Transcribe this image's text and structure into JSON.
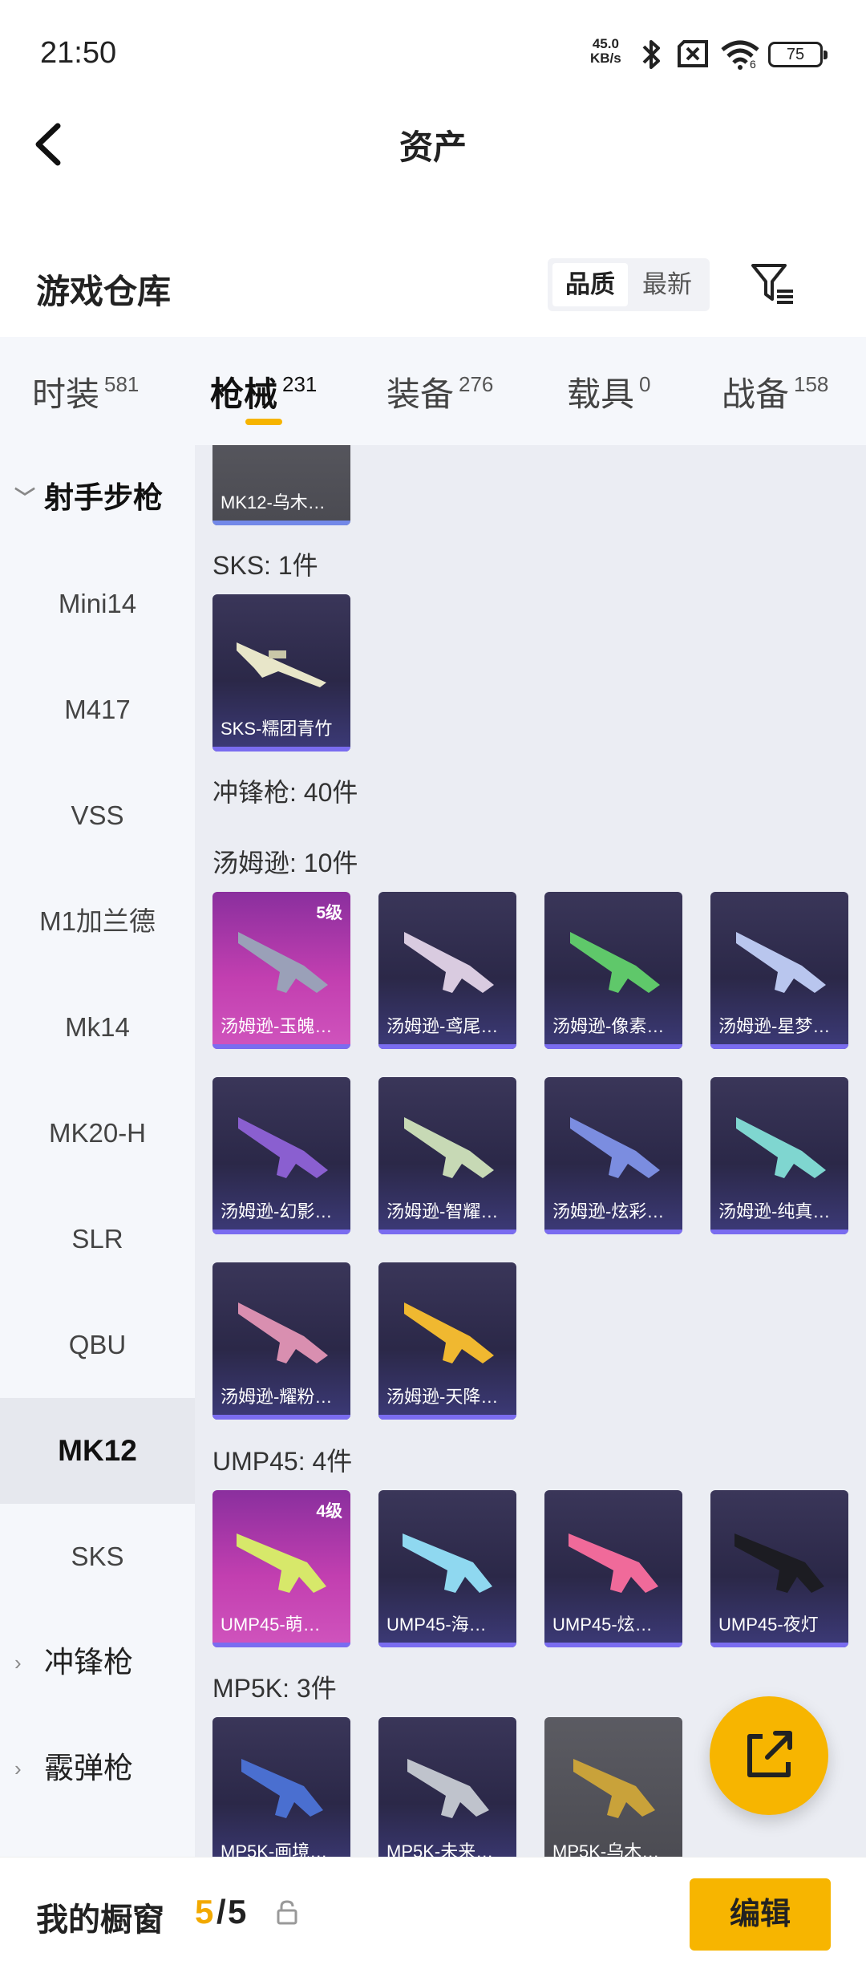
{
  "status_bar": {
    "time": "21:50",
    "net_speed": "45.0",
    "net_unit": "KB/s",
    "wifi_level": "6",
    "battery": "75"
  },
  "header": {
    "title": "资产"
  },
  "warehouse": {
    "title": "游戏仓库",
    "sort_options": [
      "品质",
      "最新"
    ],
    "sort_selected": "品质"
  },
  "tabs": [
    {
      "label": "时装",
      "count": "581",
      "active": false
    },
    {
      "label": "枪械",
      "count": "231",
      "active": true
    },
    {
      "label": "装备",
      "count": "276",
      "active": false
    },
    {
      "label": "载具",
      "count": "0",
      "active": false
    },
    {
      "label": "战备",
      "count": "158",
      "active": false
    }
  ],
  "sidebar": {
    "group_open": "射手步枪",
    "items": [
      "Mini14",
      "M417",
      "VSS",
      "M1加兰德",
      "Mk14",
      "MK20-H",
      "SLR",
      "QBU",
      "MK12",
      "SKS"
    ],
    "selected": "MK12",
    "groups_closed": [
      "冲锋枪",
      "霰弹枪"
    ]
  },
  "content": {
    "partial_top_card": "MK12-乌木…",
    "sections": [
      {
        "heading": "SKS: 1件",
        "items": [
          {
            "name": "SKS-糯团青竹",
            "level": "",
            "style": "purple"
          }
        ]
      },
      {
        "heading": "冲锋枪: 40件",
        "items": []
      },
      {
        "heading": "汤姆逊: 10件",
        "items": [
          {
            "name": "汤姆逊-玉魄…",
            "level": "5级",
            "style": "pink"
          },
          {
            "name": "汤姆逊-鸢尾…",
            "level": "",
            "style": "purple"
          },
          {
            "name": "汤姆逊-像素…",
            "level": "",
            "style": "purple"
          },
          {
            "name": "汤姆逊-星梦…",
            "level": "",
            "style": "purple"
          },
          {
            "name": "汤姆逊-幻影…",
            "level": "",
            "style": "purple"
          },
          {
            "name": "汤姆逊-智耀…",
            "level": "",
            "style": "purple"
          },
          {
            "name": "汤姆逊-炫彩…",
            "level": "",
            "style": "purple"
          },
          {
            "name": "汤姆逊-纯真…",
            "level": "",
            "style": "purple"
          },
          {
            "name": "汤姆逊-耀粉…",
            "level": "",
            "style": "purple"
          },
          {
            "name": "汤姆逊-天降…",
            "level": "",
            "style": "purple"
          }
        ]
      },
      {
        "heading": "UMP45: 4件",
        "items": [
          {
            "name": "UMP45-萌…",
            "level": "4级",
            "style": "pink"
          },
          {
            "name": "UMP45-海…",
            "level": "",
            "style": "purple"
          },
          {
            "name": "UMP45-炫…",
            "level": "",
            "style": "purple"
          },
          {
            "name": "UMP45-夜灯",
            "level": "",
            "style": "purple"
          }
        ]
      },
      {
        "heading": "MP5K: 3件",
        "items": [
          {
            "name": "MP5K-画境…",
            "level": "",
            "style": "purple"
          },
          {
            "name": "MP5K-未来…",
            "level": "",
            "style": "purple"
          },
          {
            "name": "MP5K-乌木…",
            "level": "",
            "style": "gray"
          }
        ]
      }
    ]
  },
  "bottom_bar": {
    "label": "我的橱窗",
    "current": "5",
    "separator": "/",
    "total": "5",
    "edit_label": "编辑"
  },
  "colors": {
    "accent": "#f7b500",
    "card_purple": "#2b2848",
    "card_pink": "#c23fb0"
  }
}
